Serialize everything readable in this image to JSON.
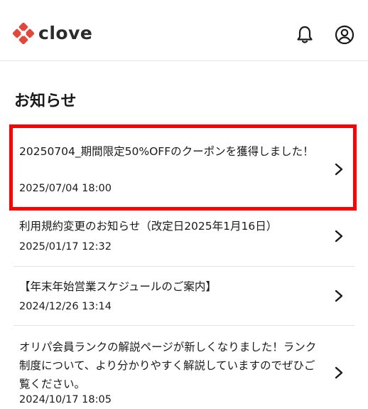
{
  "header": {
    "brand": "clove",
    "brand_color": "#e0493a",
    "notification_icon": "bell-icon",
    "account_icon": "user-circle-icon"
  },
  "page": {
    "title": "お知らせ"
  },
  "notices": [
    {
      "title": "20250704_期間限定50%OFFのクーポンを獲得しました！",
      "date": "2025/07/04 18:00",
      "highlighted": true
    },
    {
      "title": "利用規約変更のお知らせ（改定日2025年1月16日）",
      "date": "2025/01/17 12:32"
    },
    {
      "title": "【年末年始営業スケジュールのご案内】",
      "date": "2024/12/26 13:14"
    },
    {
      "title": "オリパ会員ランクの解説ページが新しくなりました！ランク制度について、より分かりやすく解説していますのでぜひご覧ください。",
      "date": "2024/10/17 18:05"
    }
  ],
  "highlight_color": "#ff0000"
}
